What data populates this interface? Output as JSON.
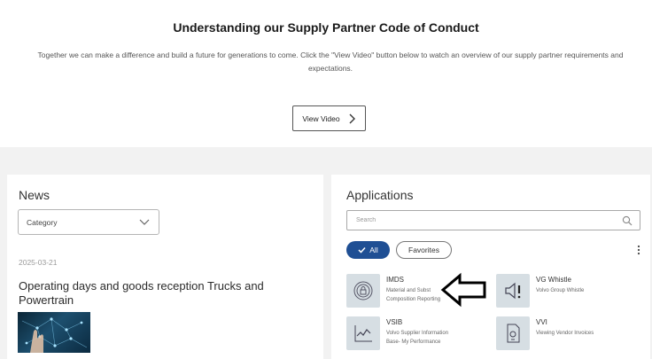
{
  "hero": {
    "title": "Understanding our Supply Partner Code of Conduct",
    "description": "Together we can make a difference and build a future for generations to come.  Click the \"View Video\" button below to watch an overview of our supply partner requirements and expectations.",
    "button_label": "View Video"
  },
  "news": {
    "title": "News",
    "category_value": "Category",
    "date": "2025-03-21",
    "headline": "Operating days and goods reception Trucks and Powertrain"
  },
  "applications": {
    "title": "Applications",
    "search_placeholder": "Search",
    "chip_all": "All",
    "chip_favorites": "Favorites",
    "items": [
      {
        "name": "IMDS",
        "desc_line1": "Material and Subst",
        "desc_line2": "Composition Reporting",
        "icon": "lock-icon"
      },
      {
        "name": "VG Whistle",
        "desc_line1": "Volvo Group Whistle",
        "desc_line2": "",
        "icon": "megaphone-icon"
      },
      {
        "name": "VSIB",
        "desc_line1": "Volvo Supplier Information",
        "desc_line2": "Base- My Performance",
        "icon": "chart-icon"
      },
      {
        "name": "VVI",
        "desc_line1": "Viewing Vendor Invoices",
        "desc_line2": "",
        "icon": "invoice-icon"
      }
    ],
    "accent_color": "#1f4f94"
  }
}
